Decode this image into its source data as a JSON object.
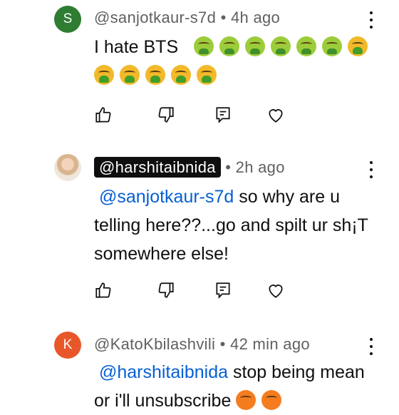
{
  "comments": [
    {
      "avatar_letter": "S",
      "avatar_color": "#2e7d32",
      "handle": "@sanjotkaur-s7d",
      "time": "• 4h ago",
      "text": "I hate BTS",
      "emoji_names": [
        "nauseated-face",
        "nauseated-face",
        "nauseated-face",
        "nauseated-face",
        "nauseated-face",
        "nauseated-face",
        "vomiting-face",
        "vomiting-face",
        "vomiting-face",
        "vomiting-face",
        "vomiting-face",
        "vomiting-face"
      ]
    },
    {
      "handle": "@harshitaibnida",
      "time": "• 2h ago",
      "mention": "@sanjotkaur-s7d",
      "text": " so why are u telling here??...go and spilt ur sh¡T somewhere else!"
    },
    {
      "avatar_letter": "K",
      "avatar_color": "#e8572a",
      "handle": "@KatoKbilashvili",
      "time": "• 42 min ago",
      "mention": "@harshitaibnida",
      "text": " stop being mean or i'll unsubscribe"
    }
  ],
  "icons": [
    "like-icon",
    "dislike-icon",
    "reply-icon",
    "heart-icon",
    "more-vert-icon"
  ],
  "accent_color": "#065fd4"
}
